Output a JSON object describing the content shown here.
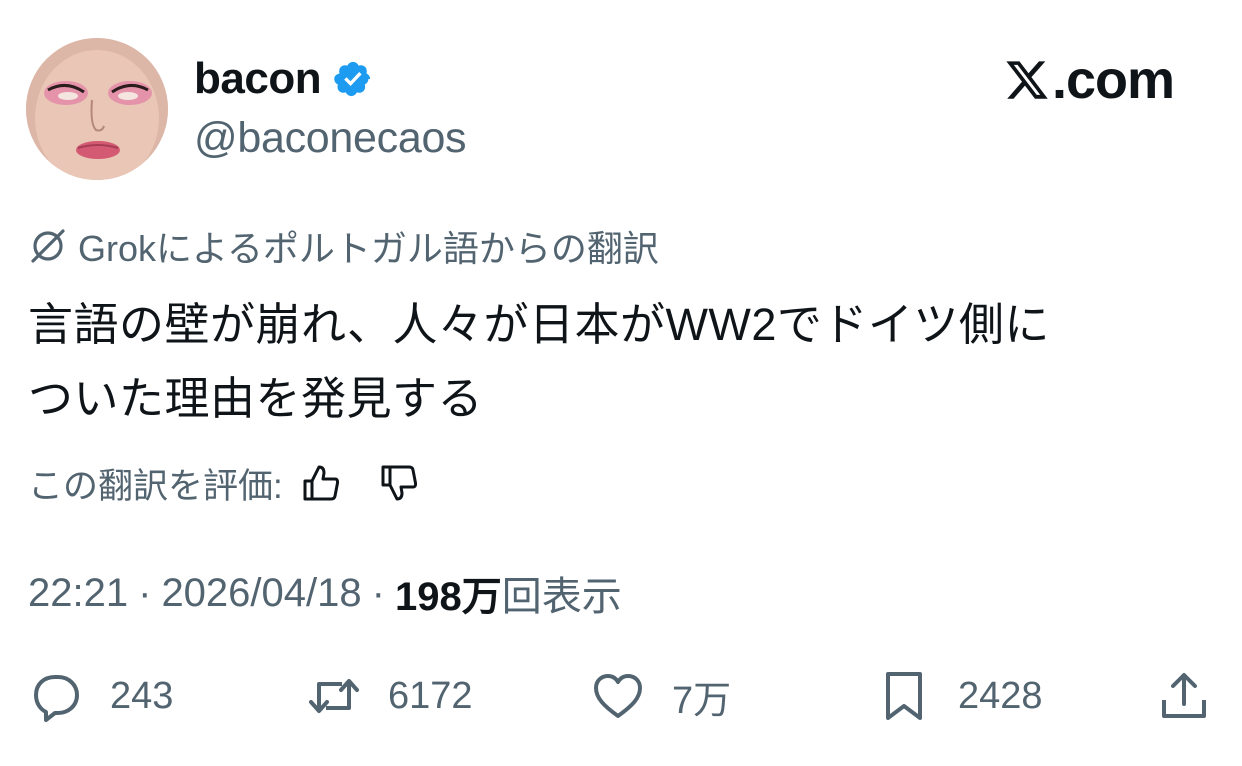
{
  "author": {
    "display_name": "bacon",
    "handle": "@baconecaos",
    "verified_icon": "verified-badge-icon",
    "verified_color": "#1d9bf0"
  },
  "brand": {
    "text": ".com",
    "icon": "x-logo-icon"
  },
  "translation": {
    "label": "Grokによるポルトガル語からの翻訳",
    "icon": "grok-icon"
  },
  "tweet": {
    "lines": [
      "言語の壁が崩れ、人々が日本がWW2でドイツ側に",
      "ついた理由を発見する"
    ]
  },
  "rating": {
    "label": "この翻訳を評価:",
    "up_icon": "thumbs-up-icon",
    "down_icon": "thumbs-down-icon"
  },
  "meta": {
    "time": "22:21",
    "separator": "·",
    "date": "2026/04/18",
    "views_count": "198万",
    "views_label": "回表示"
  },
  "actions": {
    "reply": {
      "icon": "reply-icon",
      "count": "243"
    },
    "repost": {
      "icon": "repost-icon",
      "count": "6172"
    },
    "like": {
      "icon": "heart-icon",
      "count": "7万"
    },
    "bookmark": {
      "icon": "bookmark-icon",
      "count": "2428"
    },
    "share": {
      "icon": "share-icon"
    }
  },
  "colors": {
    "text_primary": "#0f1419",
    "text_secondary": "#536471",
    "accent": "#1d9bf0"
  }
}
